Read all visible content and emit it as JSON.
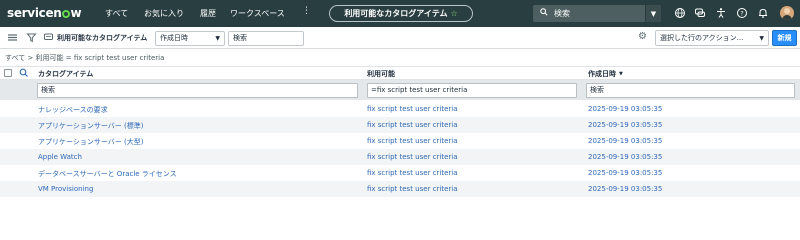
{
  "topnav": {
    "logo": "servicenow",
    "items": [
      "すべて",
      "お気に入り",
      "履歴",
      "ワークスペース"
    ],
    "more": "⋮",
    "context_title": "利用可能なカタログアイテム",
    "star_icon": "☆",
    "search_placeholder": "検索",
    "icons": [
      "globe-icon",
      "chat-icon",
      "accessibility-icon",
      "help-icon",
      "bell-icon",
      "avatar"
    ]
  },
  "toolbar": {
    "title": "利用可能なカタログアイテム",
    "field_select": "作成日時",
    "field_input_value": "検索",
    "action_select": "選択した行のアクション...",
    "new_label": "新規"
  },
  "breadcrumb": "すべて > 利用可能 = fix script test user criteria",
  "table": {
    "columns": [
      "カタログアイテム",
      "利用可能",
      "作成日時"
    ],
    "sort_indicator": "▼",
    "filters": [
      "検索",
      "=fix script test user criteria",
      "検索"
    ],
    "rows": [
      {
        "item": "ナレッジベースの要求",
        "available": "fix script test user criteria",
        "created": "2025-09-19 03:05:35"
      },
      {
        "item": "アプリケーションサーバー (標準)",
        "available": "fix script test user criteria",
        "created": "2025-09-19 03:05:35"
      },
      {
        "item": "アプリケーションサーバー (大型)",
        "available": "fix script test user criteria",
        "created": "2025-09-19 03:05:35"
      },
      {
        "item": "Apple Watch",
        "available": "fix script test user criteria",
        "created": "2025-09-19 03:05:35"
      },
      {
        "item": "データベースサーバーと Oracle ライセンス",
        "available": "fix script test user criteria",
        "created": "2025-09-19 03:05:35"
      },
      {
        "item": "VM Provisioning",
        "available": "fix script test user criteria",
        "created": "2025-09-19 03:05:35"
      }
    ]
  },
  "colors": {
    "topnav_bg": "#293e40",
    "link": "#2d68b8",
    "new_button": "#278efc",
    "logo_accent": "#62d84e"
  }
}
